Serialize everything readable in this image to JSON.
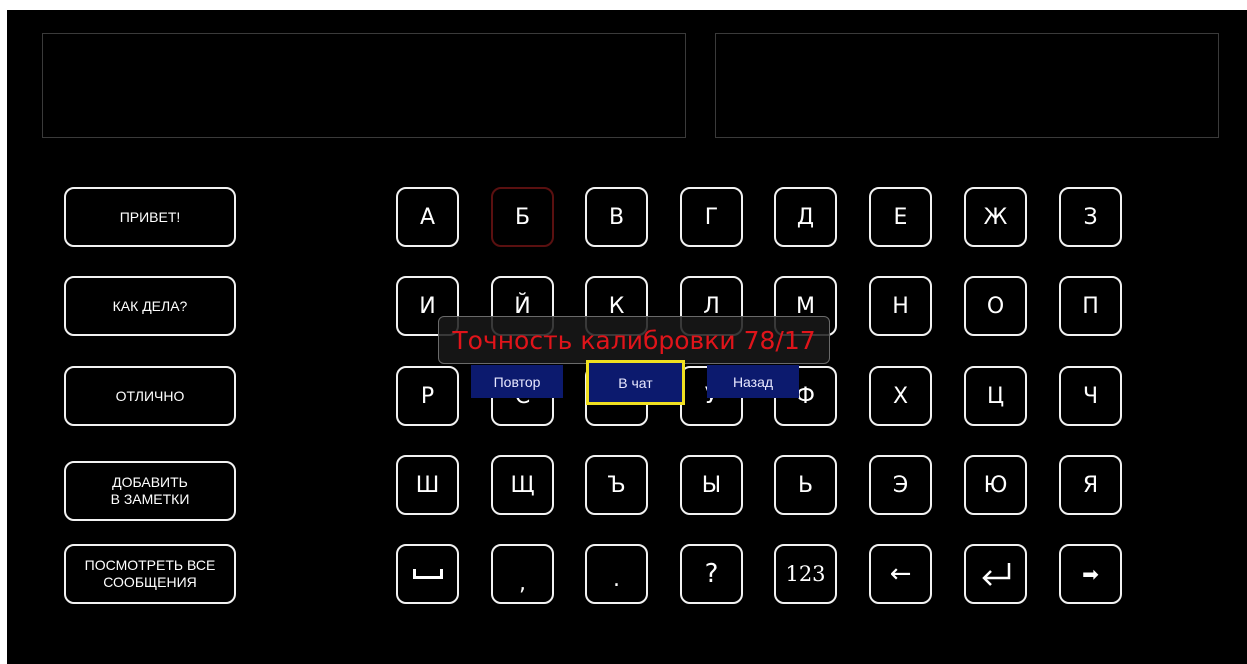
{
  "phrases": [
    {
      "label": "ПРИВЕТ!"
    },
    {
      "label": "КАК ДЕЛА?"
    },
    {
      "label": "ОТЛИЧНО"
    },
    {
      "label": "ДОБАВИТЬ\nВ ЗАМЕТКИ"
    },
    {
      "label": "ПОСМОТРЕТЬ ВСЕ\nСООБЩЕНИЯ"
    }
  ],
  "keys_row1": [
    "А",
    "Б",
    "В",
    "Г",
    "Д",
    "Е",
    "Ж",
    "З"
  ],
  "keys_row2": [
    "И",
    "Й",
    "К",
    "Л",
    "М",
    "Н",
    "О",
    "П"
  ],
  "keys_row3": [
    "Р",
    "С",
    "Т",
    "У",
    "Ф",
    "Х",
    "Ц",
    "Ч"
  ],
  "keys_row4": [
    "Ш",
    "Щ",
    "Ъ",
    "Ы",
    "Ь",
    "Э",
    "Ю",
    "Я"
  ],
  "keys_row5": {
    "comma": ",",
    "period": ".",
    "question": "?",
    "numbers": "123",
    "backspace": "←",
    "enter": "⏎",
    "next": "➡"
  },
  "dialog": {
    "calibration_text": "Точность калибровки 78/17",
    "repeat_label": "Повтор",
    "to_chat_label": "В чат",
    "back_label": "Назад"
  },
  "colors": {
    "background": "#000000",
    "key_border": "#f2f2f2",
    "highlight_key_border": "#5a1010",
    "dialog_text": "#e0141a",
    "dialog_button": "#0c1a6e",
    "focus": "#f0e020"
  },
  "icons": {
    "space": "space-bar-icon",
    "backspace": "arrow-left-icon",
    "enter": "enter-return-icon",
    "next": "arrow-right-icon"
  }
}
